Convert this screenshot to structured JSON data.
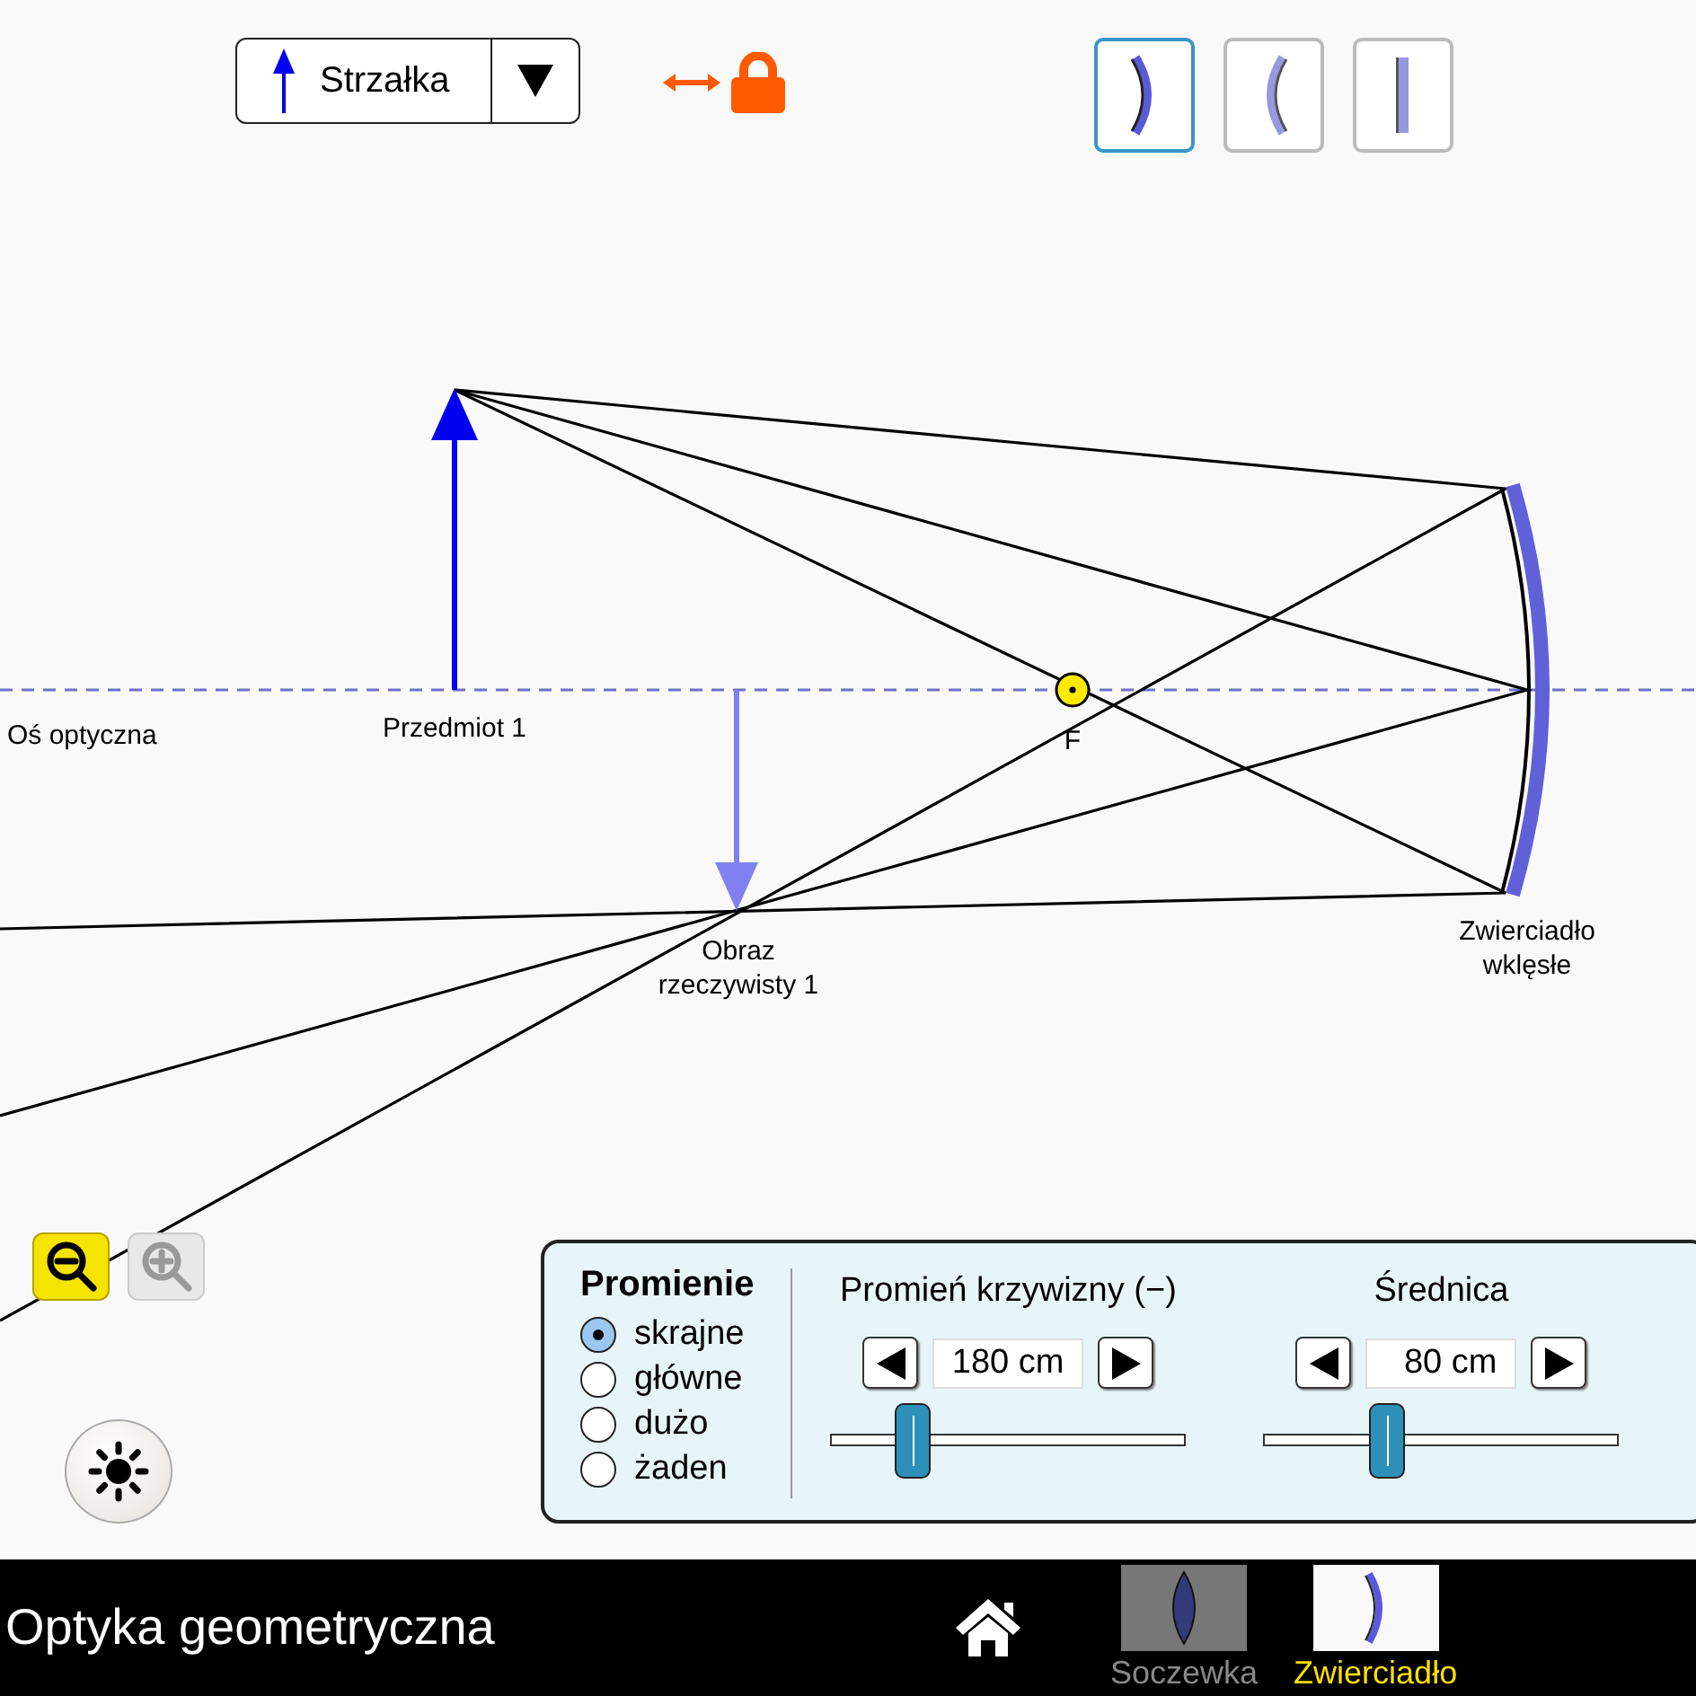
{
  "object_selector": {
    "label": "Strzałka"
  },
  "optic_types": [
    {
      "kind": "concave",
      "selected": true
    },
    {
      "kind": "convex",
      "selected": false
    },
    {
      "kind": "flat",
      "selected": false
    }
  ],
  "scene": {
    "axis_label": "Oś optyczna",
    "object_label": "Przedmiot 1",
    "focus_label": "F",
    "image_label": [
      "Obraz",
      "rzeczywisty 1"
    ],
    "mirror_label": [
      "Zwierciadło",
      "wklęsłe"
    ]
  },
  "zoom_buttons": [
    {
      "kind": "out",
      "disabled": false
    },
    {
      "kind": "in",
      "disabled": true
    }
  ],
  "rays": {
    "title": "Promienie",
    "options": [
      {
        "label": "skrajne",
        "selected": true
      },
      {
        "label": "główne",
        "selected": false
      },
      {
        "label": "dużo",
        "selected": false
      },
      {
        "label": "żaden",
        "selected": false
      }
    ]
  },
  "controls": [
    {
      "label": "Promień krzywizny (−)",
      "value": "180 cm",
      "level": 0.2
    },
    {
      "label": "Średnica",
      "value": "80 cm",
      "level": 0.33
    }
  ],
  "navbar": {
    "title": "Optyka geometryczna",
    "screens": [
      {
        "kind": "lens",
        "label": "Soczewka",
        "selected": false
      },
      {
        "kind": "mirror",
        "label": "Zwierciadło",
        "selected": true
      }
    ]
  }
}
